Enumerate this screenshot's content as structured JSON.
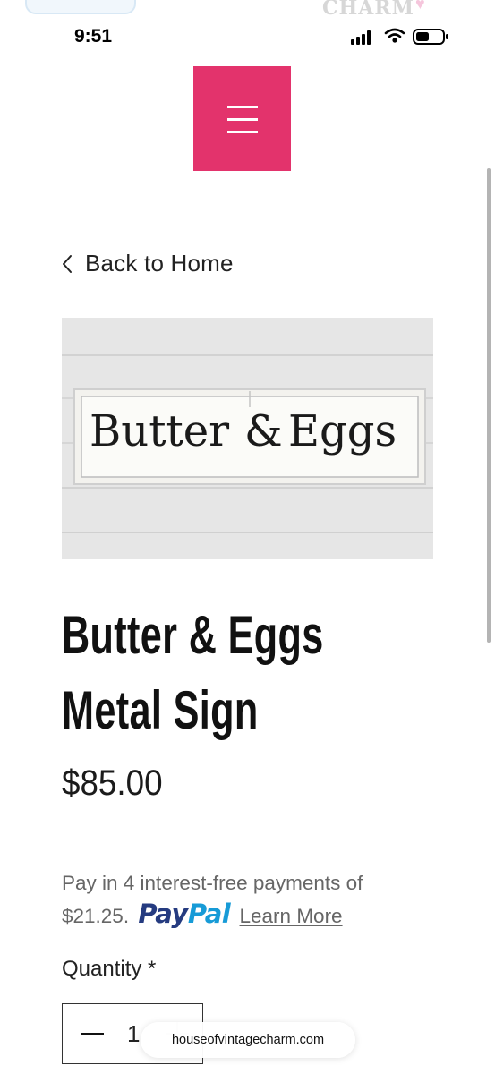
{
  "status_bar": {
    "time": "9:51"
  },
  "header": {
    "partial_logo_text": "CHARM",
    "menu_icon": "hamburger-menu-icon",
    "menu_color": "#e3336c"
  },
  "navigation": {
    "back_label": "Back to Home",
    "back_icon": "chevron-left-icon"
  },
  "product": {
    "image_text_left": "Butter",
    "image_text_amp": "&",
    "image_text_right": "Eggs",
    "title_line1": "Butter & Eggs",
    "title_line2": "Metal Sign",
    "price": "$85.00"
  },
  "paypal": {
    "message_line1": "Pay in 4 interest-free payments of",
    "amount": "$21.25.",
    "logo_pay": "Pay",
    "logo_pal": "Pal",
    "learn_more": "Learn More",
    "colors": {
      "pay": "#253b80",
      "pal": "#179bd7"
    }
  },
  "quantity": {
    "label": "Quantity *",
    "value": "1"
  },
  "browser": {
    "url": "houseofvintagecharm.com"
  }
}
